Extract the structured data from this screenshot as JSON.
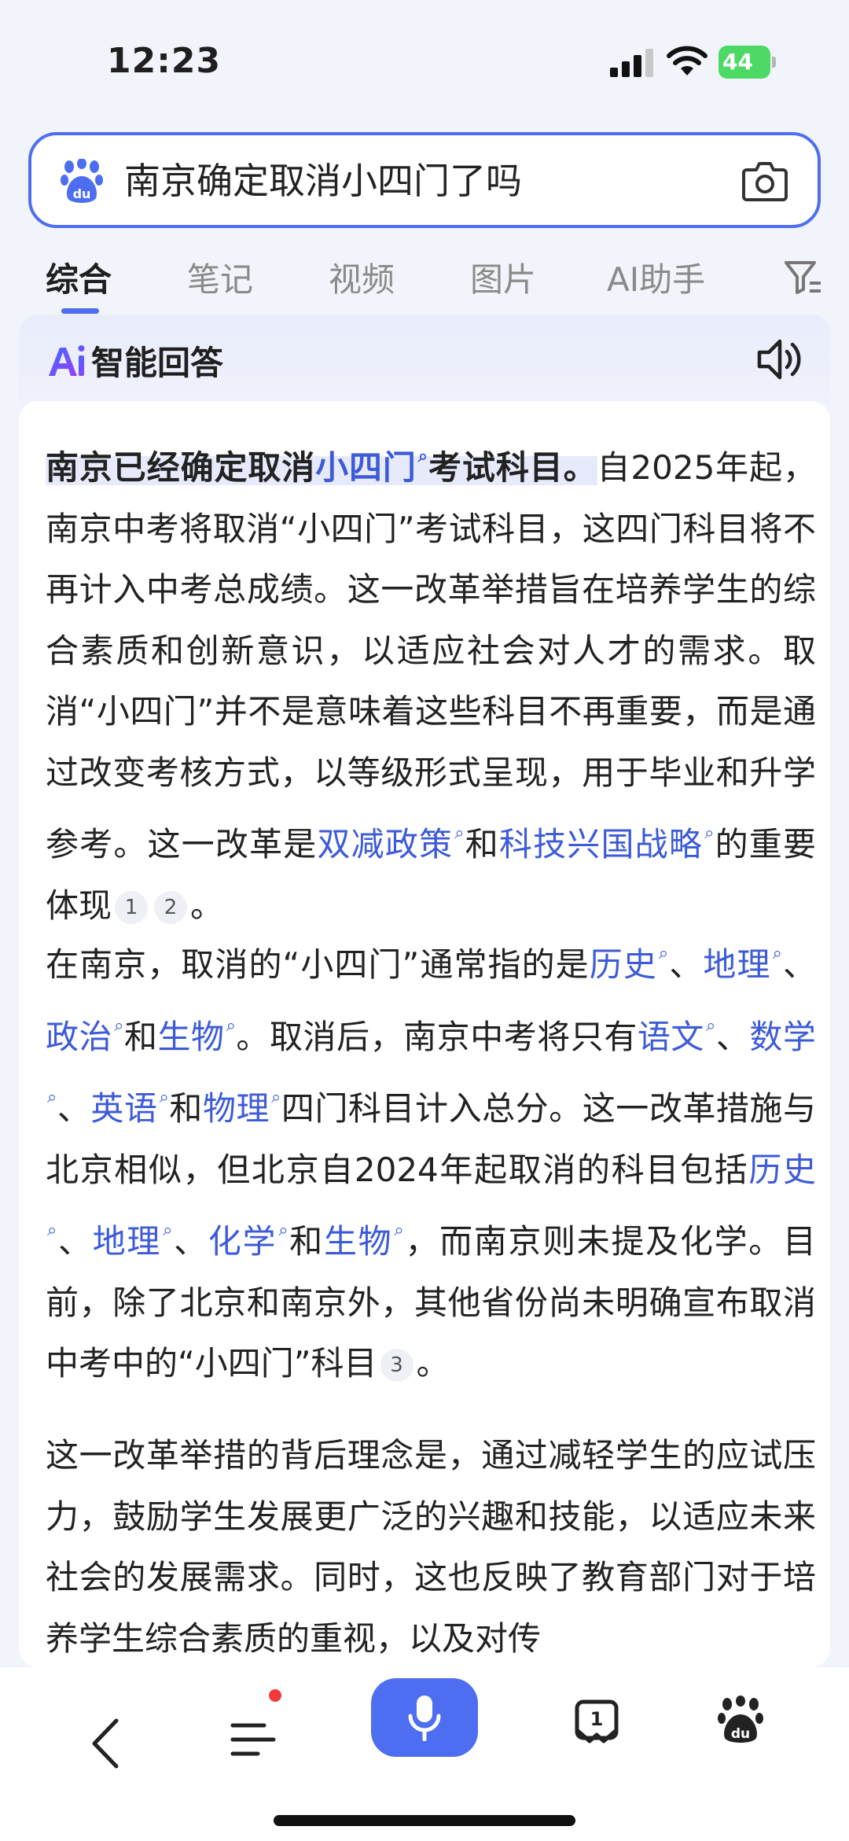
{
  "status_bar": {
    "time": "12:23",
    "battery": "44"
  },
  "search": {
    "query": "南京确定取消小四门了吗"
  },
  "tabs": [
    {
      "label": "综合",
      "active": true
    },
    {
      "label": "笔记",
      "active": false
    },
    {
      "label": "视频",
      "active": false
    },
    {
      "label": "图片",
      "active": false
    },
    {
      "label": "AI助手",
      "active": false
    }
  ],
  "ai_answer": {
    "header": "智能回答",
    "paragraphs": {
      "p1": [
        {
          "type": "highlight",
          "text": "南京已经确定取消"
        },
        {
          "type": "highlight-link",
          "text": "小四门"
        },
        {
          "type": "highlight",
          "text": "考试科目。"
        },
        {
          "type": "text",
          "text": "自2025年起，南京中考将取消“小四门”考试科目，这四门科目将不再计入中考总成绩。这一改革举措旨在培养学生的综合素质和创新意识，以适应社会对人才的需求。取消“小四门”并不是意味着这些科目不再重要，而是通过改变考核方式，以等级形式呈现，用于毕业和升学参考。这一改革是"
        },
        {
          "type": "link",
          "text": "双减政策"
        },
        {
          "type": "text",
          "text": "和"
        },
        {
          "type": "link",
          "text": "科技兴国战略"
        },
        {
          "type": "text",
          "text": "的重要体现"
        },
        {
          "type": "cite",
          "text": "1"
        },
        {
          "type": "cite",
          "text": "2"
        },
        {
          "type": "text",
          "text": "。"
        }
      ],
      "p2": [
        {
          "type": "text",
          "text": "在南京，取消的“小四门”通常指的是"
        },
        {
          "type": "link",
          "text": "历史"
        },
        {
          "type": "text",
          "text": "、"
        },
        {
          "type": "link",
          "text": "地理"
        },
        {
          "type": "text",
          "text": "、"
        },
        {
          "type": "link",
          "text": "政治"
        },
        {
          "type": "text",
          "text": "和"
        },
        {
          "type": "link",
          "text": "生物"
        },
        {
          "type": "text",
          "text": "。取消后，南京中考将只有"
        },
        {
          "type": "link",
          "text": "语文"
        },
        {
          "type": "text",
          "text": "、"
        },
        {
          "type": "link",
          "text": "数学"
        },
        {
          "type": "text",
          "text": "、"
        },
        {
          "type": "link",
          "text": "英语"
        },
        {
          "type": "text",
          "text": "和"
        },
        {
          "type": "link",
          "text": "物理"
        },
        {
          "type": "text",
          "text": "四门科目计入总分。这一改革措施与北京相似，但北京自2024年起取消的科目包括"
        },
        {
          "type": "link",
          "text": "历史"
        },
        {
          "type": "text",
          "text": "、"
        },
        {
          "type": "link",
          "text": "地理"
        },
        {
          "type": "text",
          "text": "、"
        },
        {
          "type": "link",
          "text": "化学"
        },
        {
          "type": "text",
          "text": "和"
        },
        {
          "type": "link",
          "text": "生物"
        },
        {
          "type": "text",
          "text": "，而南京则未提及化学。目前，除了北京和南京外，其他省份尚未明确宣布取消中考中的“小四门”科目"
        },
        {
          "type": "cite",
          "text": "3"
        },
        {
          "type": "text",
          "text": "。"
        }
      ],
      "p3": [
        {
          "type": "text",
          "text": "这一改革举措的背后理念是，通过减轻学生的应试压力，鼓励学生发展更广泛的兴趣和技能，以适应未来社会的发展需求。同时，这也反映了教育部门对于培养学生综合素质的重视，以及对传"
        }
      ]
    }
  },
  "colors": {
    "accent": "#4e6ef2",
    "link": "#3d5bd9",
    "notification_dot": "#f23a3a",
    "battery": "#4cd964"
  },
  "bottom_nav": {
    "tab_count": "1"
  }
}
